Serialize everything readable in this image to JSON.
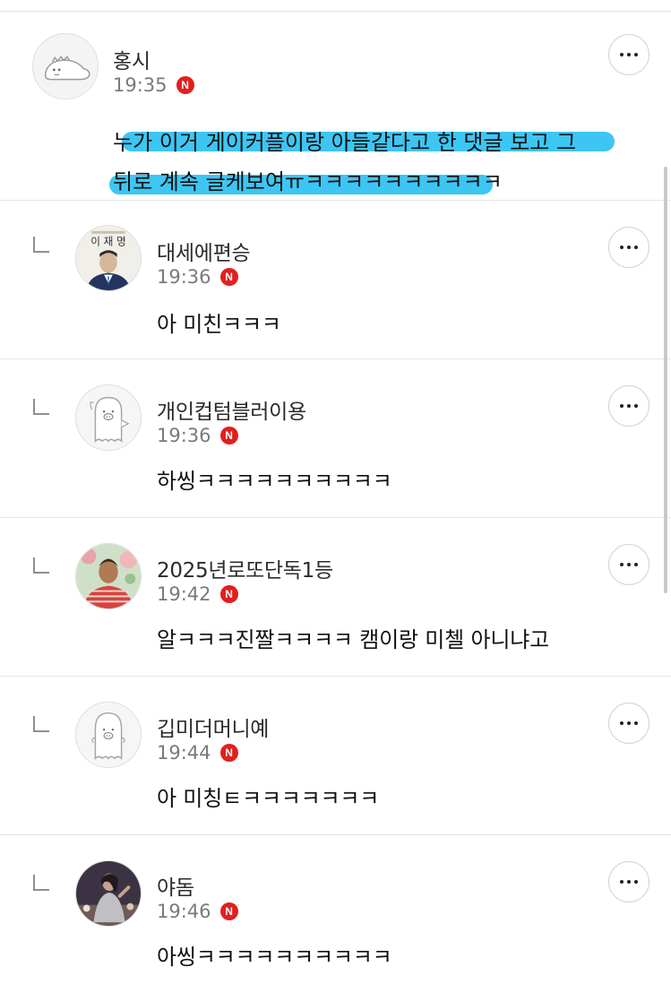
{
  "comments": [
    {
      "nickname": "홍시",
      "time": "19:35",
      "badge": "N",
      "body_lines": [
        "누가 이거 게이커플이랑 아들같다고 한 댓글 보고 그",
        "뒤로 계속 글케보여ㅠㅋㅋㅋㅋㅋㅋㅋㅋㅋㅋ"
      ],
      "avatar": "dinosaur-avatar",
      "highlight_color": "#33c3f2",
      "reply": false
    },
    {
      "nickname": "대세에편승",
      "time": "19:36",
      "badge": "N",
      "body": "아 미친ㅋㅋㅋ",
      "avatar_caption": "이 재 명",
      "avatar": "politician-photo-avatar",
      "reply": true
    },
    {
      "nickname": "개인컵텀블러이용",
      "time": "19:36",
      "badge": "N",
      "body": "하씽ㅋㅋㅋㅋㅋㅋㅋㅋㅋㅋ",
      "avatar": "pig-ghost-avatar",
      "reply": true
    },
    {
      "nickname": "2025년로또단독1등",
      "time": "19:42",
      "badge": "N",
      "body": "알ㅋㅋㅋ진짤ㅋㅋㅋㅋ 캠이랑 미첼 아니냐고",
      "avatar": "man-photo-avatar",
      "reply": true
    },
    {
      "nickname": "깁미더머니예",
      "time": "19:44",
      "badge": "N",
      "body": "아 미칭ㅌㅋㅋㅋㅋㅋㅋㅋ",
      "avatar": "pig-ghost-avatar",
      "reply": true
    },
    {
      "nickname": "야돔",
      "time": "19:46",
      "badge": "N",
      "body": "아씽ㅋㅋㅋㅋㅋㅋㅋㅋㅋㅋ",
      "avatar": "woman-photo-avatar",
      "reply": true
    }
  ],
  "colors": {
    "badge": "#e0201f",
    "time": "#7a7a7a",
    "divider": "#e6e6e6"
  },
  "icons": {
    "more": "more-dots-icon",
    "reply": "reply-indent-icon",
    "badge": "new-badge-icon"
  }
}
